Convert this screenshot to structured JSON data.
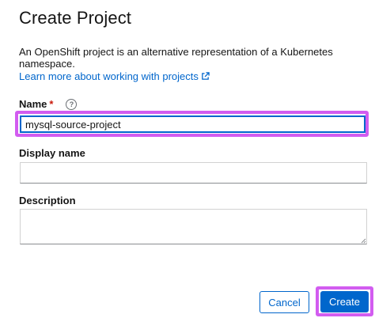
{
  "dialog": {
    "title": "Create Project",
    "description": "An OpenShift project is an alternative representation of a Kubernetes namespace.",
    "learn_more_link": "Learn more about working with projects"
  },
  "fields": {
    "name": {
      "label": "Name",
      "required_marker": "*",
      "value": "mysql-source-project"
    },
    "display_name": {
      "label": "Display name",
      "value": ""
    },
    "description": {
      "label": "Description",
      "value": ""
    }
  },
  "buttons": {
    "cancel": "Cancel",
    "create": "Create"
  },
  "colors": {
    "link": "#0066cc",
    "primary": "#0066cc",
    "required": "#c9190b",
    "highlight": "#d25cf0"
  }
}
